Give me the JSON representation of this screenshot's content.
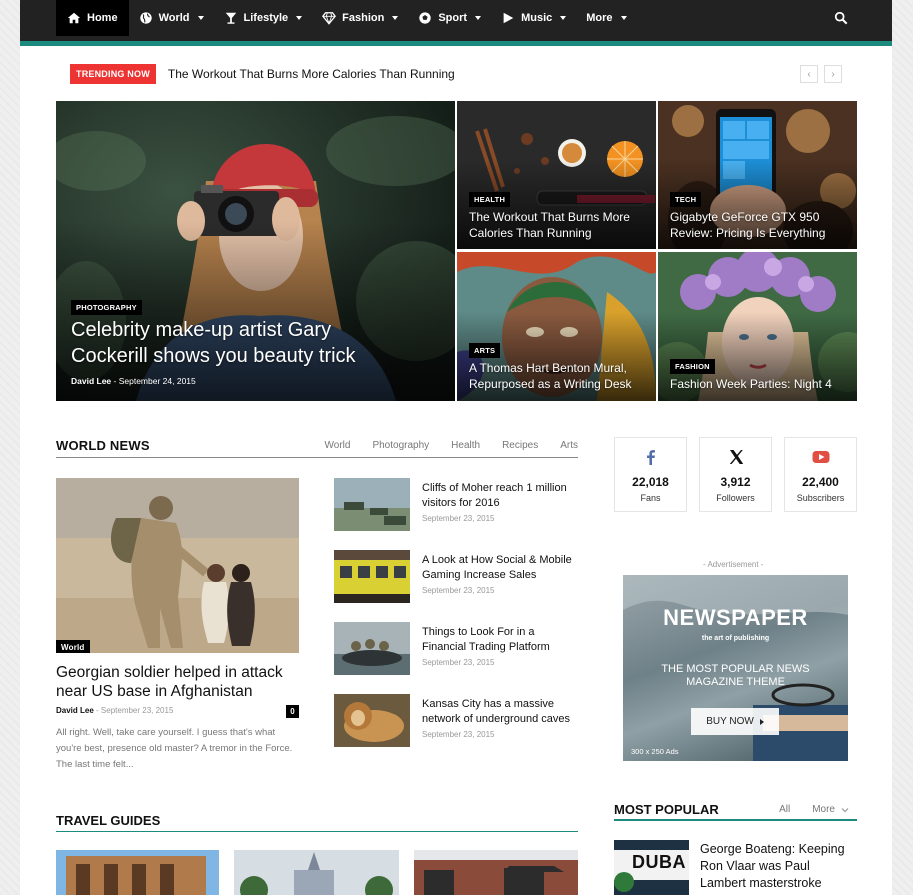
{
  "nav": {
    "items": [
      {
        "label": "Home",
        "icon": "home-icon",
        "active": true
      },
      {
        "label": "World",
        "icon": "globe-icon"
      },
      {
        "label": "Lifestyle",
        "icon": "glass-icon"
      },
      {
        "label": "Fashion",
        "icon": "diamond-icon"
      },
      {
        "label": "Sport",
        "icon": "ball-icon"
      },
      {
        "label": "Music",
        "icon": "play-icon"
      },
      {
        "label": "More"
      }
    ],
    "search_icon": "search-icon"
  },
  "trending": {
    "badge": "TRENDING NOW",
    "headline": "The Workout That Burns More Calories Than Running",
    "prev": "‹",
    "next": "›"
  },
  "hero": {
    "main": {
      "category": "PHOTOGRAPHY",
      "title_line1": "Celebrity make-up artist Gary",
      "title_line2": "Cockerill shows you beauty trick",
      "author": "David Lee",
      "sep": " - ",
      "date": "September 24, 2015"
    },
    "tiles": [
      {
        "category": "HEALTH",
        "line1": "The Workout That Burns More",
        "line2": "Calories Than Running"
      },
      {
        "category": "TECH",
        "line1": "Gigabyte GeForce GTX 950",
        "line2": "Review: Pricing Is Everything"
      },
      {
        "category": "ARTS",
        "line1": "A Thomas Hart Benton Mural,",
        "line2": "Repurposed as a Writing Desk"
      },
      {
        "category": "FASHION",
        "line1": "Fashion Week Parties: Night 4",
        "line2": ""
      }
    ]
  },
  "world_news": {
    "title": "WORLD NEWS",
    "tabs": [
      "World",
      "Photography",
      "Health",
      "Recipes",
      "Arts"
    ],
    "featured": {
      "category": "World",
      "title": "Georgian soldier helped in attack near US base in Afghanistan",
      "author": "David Lee",
      "sep": " - ",
      "date": "September 23, 2015",
      "comments": "0",
      "excerpt": "All right. Well, take care yourself. I guess that's what you're best, presence old master? A tremor in the Force. The last time felt..."
    },
    "list": [
      {
        "title": "Cliffs of Moher reach 1 million visitors for 2016",
        "date": "September 23, 2015"
      },
      {
        "title": "A Look at How Social & Mobile Gaming Increase Sales",
        "date": "September 23, 2015"
      },
      {
        "title": "Things to Look For in a Financial Trading Platform",
        "date": "September 23, 2015"
      },
      {
        "title": "Kansas City has a massive network of underground caves",
        "date": "September 23, 2015"
      }
    ]
  },
  "social": [
    {
      "icon": "facebook-icon",
      "count": "22,018",
      "label": "Fans",
      "color": "#516eab"
    },
    {
      "icon": "x-icon",
      "count": "3,912",
      "label": "Followers",
      "color": "#111111"
    },
    {
      "icon": "youtube-icon",
      "count": "22,400",
      "label": "Subscribers",
      "color": "#e14e42"
    }
  ],
  "ad": {
    "label": "- Advertisement -",
    "title": "NEWSPAPER",
    "subtitle": "the art of publishing",
    "line1": "THE MOST POPULAR NEWS",
    "line2": "MAGAZINE THEME",
    "button": "BUY NOW",
    "size": "300 x 250 Ads"
  },
  "popular": {
    "title": "MOST POPULAR",
    "tabs": [
      "All",
      "More"
    ],
    "item_title": "George Boateng: Keeping Ron Vlaar was Paul Lambert masterstroke",
    "thumb_text": "DUBA"
  },
  "travel": {
    "title": "TRAVEL GUIDES"
  },
  "colors": {
    "accent": "#1b8a7f",
    "trending": "#e33333",
    "nav_bg": "#222222"
  }
}
